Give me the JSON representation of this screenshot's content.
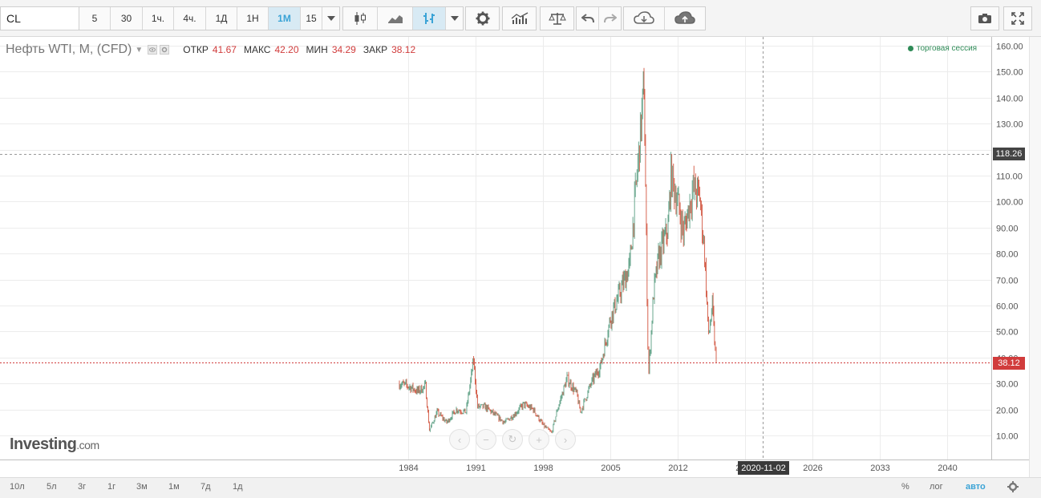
{
  "toolbar": {
    "symbol": "CL",
    "intervals": [
      "5",
      "30",
      "1ч.",
      "4ч.",
      "1Д",
      "1Н",
      "1М",
      "15"
    ],
    "active_interval": "1М"
  },
  "legend": {
    "title": "Нефть WTI, M, (CFD)",
    "open_label": "ОТКР",
    "open": "41.67",
    "high_label": "МАКС",
    "high": "42.20",
    "low_label": "МИН",
    "low": "34.29",
    "close_label": "ЗАКР",
    "close": "38.12"
  },
  "session": "торговая сессия",
  "crosshair_price": "118.26",
  "last_price": "38.12",
  "crosshair_date": "2020-11-02",
  "logo": {
    "brand": "Investing",
    "suffix": ".com"
  },
  "ranges": [
    "10л",
    "5л",
    "3г",
    "1г",
    "3м",
    "1м",
    "7д",
    "1д"
  ],
  "scale_options": [
    "%",
    "лог",
    "авто"
  ],
  "active_scale": "авто",
  "colors": {
    "up": "#5a9e82",
    "down": "#d2553f",
    "accent": "#3aa3d6",
    "last_price": "#d13c3c"
  },
  "chart_data": {
    "type": "candlestick",
    "x_ticks": [
      "1984",
      "1991",
      "1998",
      "2005",
      "2012",
      "2019",
      "2026",
      "2033",
      "2040"
    ],
    "y_ticks": [
      "10.00",
      "20.00",
      "30.00",
      "40.00",
      "50.00",
      "60.00",
      "70.00",
      "80.00",
      "90.00",
      "100.00",
      "110.00",
      "120.00",
      "130.00",
      "140.00",
      "150.00",
      "160.00"
    ],
    "ylim": [
      0,
      160
    ],
    "series": [
      {
        "year": 1983.0,
        "close": 30
      },
      {
        "year": 1984.0,
        "close": 29
      },
      {
        "year": 1985.0,
        "close": 27
      },
      {
        "year": 1985.8,
        "close": 29
      },
      {
        "year": 1986.2,
        "close": 12
      },
      {
        "year": 1987.0,
        "close": 19
      },
      {
        "year": 1988.0,
        "close": 15
      },
      {
        "year": 1989.0,
        "close": 20
      },
      {
        "year": 1990.0,
        "close": 19
      },
      {
        "year": 1990.8,
        "close": 39
      },
      {
        "year": 1991.2,
        "close": 21
      },
      {
        "year": 1992.0,
        "close": 21
      },
      {
        "year": 1993.0,
        "close": 18
      },
      {
        "year": 1994.0,
        "close": 15
      },
      {
        "year": 1995.0,
        "close": 18
      },
      {
        "year": 1996.0,
        "close": 22
      },
      {
        "year": 1997.0,
        "close": 20
      },
      {
        "year": 1998.0,
        "close": 14
      },
      {
        "year": 1998.9,
        "close": 11
      },
      {
        "year": 1999.5,
        "close": 20
      },
      {
        "year": 2000.5,
        "close": 32
      },
      {
        "year": 2001.5,
        "close": 26
      },
      {
        "year": 2001.9,
        "close": 19
      },
      {
        "year": 2003.0,
        "close": 30
      },
      {
        "year": 2004.0,
        "close": 37
      },
      {
        "year": 2005.0,
        "close": 55
      },
      {
        "year": 2006.0,
        "close": 65
      },
      {
        "year": 2007.0,
        "close": 75
      },
      {
        "year": 2008.2,
        "close": 130
      },
      {
        "year": 2008.5,
        "close": 145
      },
      {
        "year": 2008.9,
        "close": 45
      },
      {
        "year": 2009.0,
        "close": 35
      },
      {
        "year": 2009.5,
        "close": 65
      },
      {
        "year": 2010.0,
        "close": 78
      },
      {
        "year": 2011.0,
        "close": 90
      },
      {
        "year": 2011.3,
        "close": 110
      },
      {
        "year": 2012.0,
        "close": 100
      },
      {
        "year": 2012.6,
        "close": 88
      },
      {
        "year": 2013.0,
        "close": 95
      },
      {
        "year": 2013.6,
        "close": 105
      },
      {
        "year": 2014.3,
        "close": 102
      },
      {
        "year": 2014.8,
        "close": 80
      },
      {
        "year": 2015.2,
        "close": 48
      },
      {
        "year": 2015.6,
        "close": 60
      },
      {
        "year": 2015.9,
        "close": 42
      },
      {
        "year": 2016.0,
        "close": 38.12
      }
    ]
  }
}
